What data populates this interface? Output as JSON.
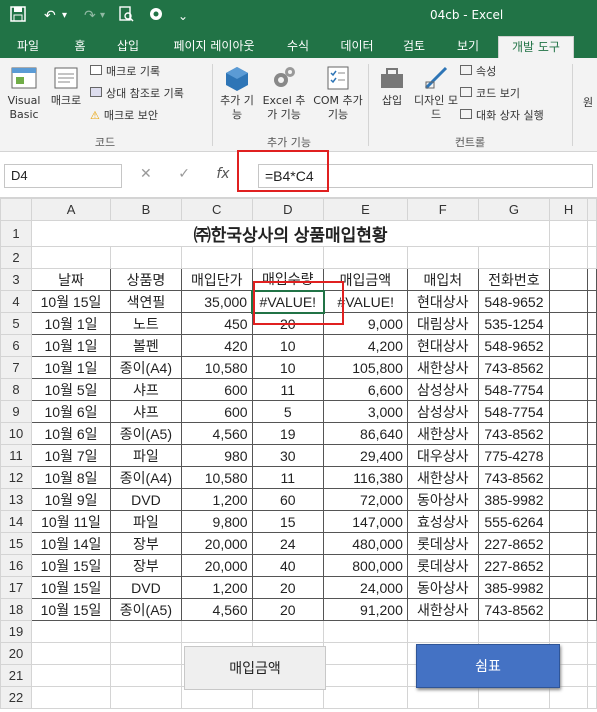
{
  "titlebar": {
    "title": "04cb - Excel"
  },
  "tabs": [
    "파일",
    "홈",
    "삽입",
    "페이지 레이아웃",
    "수식",
    "데이터",
    "검토",
    "보기",
    "개발 도구"
  ],
  "ribbon": {
    "visual_basic": "Visual Basic",
    "macro": "매크로",
    "record_macro": "매크로 기록",
    "relative_ref": "상대 참조로 기록",
    "macro_security": "매크로 보안",
    "group_code": "코드",
    "addins": "추가 기능",
    "excel_addins": "Excel 추가 기능",
    "com_addins": "COM 추가 기능",
    "group_addins": "추가 기능",
    "insert": "삽입",
    "design_mode": "디자인 모드",
    "properties": "속성",
    "view_code": "코드 보기",
    "run_dialog": "대화 상자 실행",
    "group_controls": "컨트롤",
    "source": "원"
  },
  "formula_bar": {
    "name_box": "D4",
    "formula": "=B4*C4"
  },
  "sheet": {
    "columns": [
      "A",
      "B",
      "C",
      "D",
      "E",
      "F",
      "G",
      "H"
    ],
    "title": "㈜한국상사의 상품매입현황",
    "headers": [
      "날짜",
      "상품명",
      "매입단가",
      "매입수량",
      "매입금액",
      "매입처",
      "전화번호"
    ],
    "rows": [
      [
        "10월 15일",
        "색연필",
        "35,000",
        "#VALUE!",
        "#VALUE!",
        "현대상사",
        "548-9652"
      ],
      [
        "10월 1일",
        "노트",
        "450",
        "20",
        "9,000",
        "대림상사",
        "535-1254"
      ],
      [
        "10월 1일",
        "볼펜",
        "420",
        "10",
        "4,200",
        "현대상사",
        "548-9652"
      ],
      [
        "10월 1일",
        "종이(A4)",
        "10,580",
        "10",
        "105,800",
        "새한상사",
        "743-8562"
      ],
      [
        "10월 5일",
        "샤프",
        "600",
        "11",
        "6,600",
        "삼성상사",
        "548-7754"
      ],
      [
        "10월 6일",
        "샤프",
        "600",
        "5",
        "3,000",
        "삼성상사",
        "548-7754"
      ],
      [
        "10월 6일",
        "종이(A5)",
        "4,560",
        "19",
        "86,640",
        "새한상사",
        "743-8562"
      ],
      [
        "10월 7일",
        "파일",
        "980",
        "30",
        "29,400",
        "대우상사",
        "775-4278"
      ],
      [
        "10월 8일",
        "종이(A4)",
        "10,580",
        "11",
        "116,380",
        "새한상사",
        "743-8562"
      ],
      [
        "10월 9일",
        "DVD",
        "1,200",
        "60",
        "72,000",
        "동아상사",
        "385-9982"
      ],
      [
        "10월 11일",
        "파일",
        "9,800",
        "15",
        "147,000",
        "효성상사",
        "555-6264"
      ],
      [
        "10월 14일",
        "장부",
        "20,000",
        "24",
        "480,000",
        "롯데상사",
        "227-8652"
      ],
      [
        "10월 15일",
        "장부",
        "20,000",
        "40",
        "800,000",
        "롯데상사",
        "227-8652"
      ],
      [
        "10월 15일",
        "DVD",
        "1,200",
        "20",
        "24,000",
        "동아상사",
        "385-9982"
      ],
      [
        "10월 15일",
        "종이(A5)",
        "4,560",
        "20",
        "91,200",
        "새한상사",
        "743-8562"
      ]
    ],
    "row_numbers": [
      "1",
      "2",
      "3",
      "4",
      "5",
      "6",
      "7",
      "8",
      "9",
      "10",
      "11",
      "12",
      "13",
      "14",
      "15",
      "16",
      "17",
      "18",
      "19",
      "20",
      "21",
      "22"
    ],
    "button_purchase": "매입금액",
    "button_chart": "쉼표"
  },
  "colors": {
    "excel_green": "#217346",
    "highlight_red": "#e02020",
    "button_blue": "#4472c4"
  }
}
